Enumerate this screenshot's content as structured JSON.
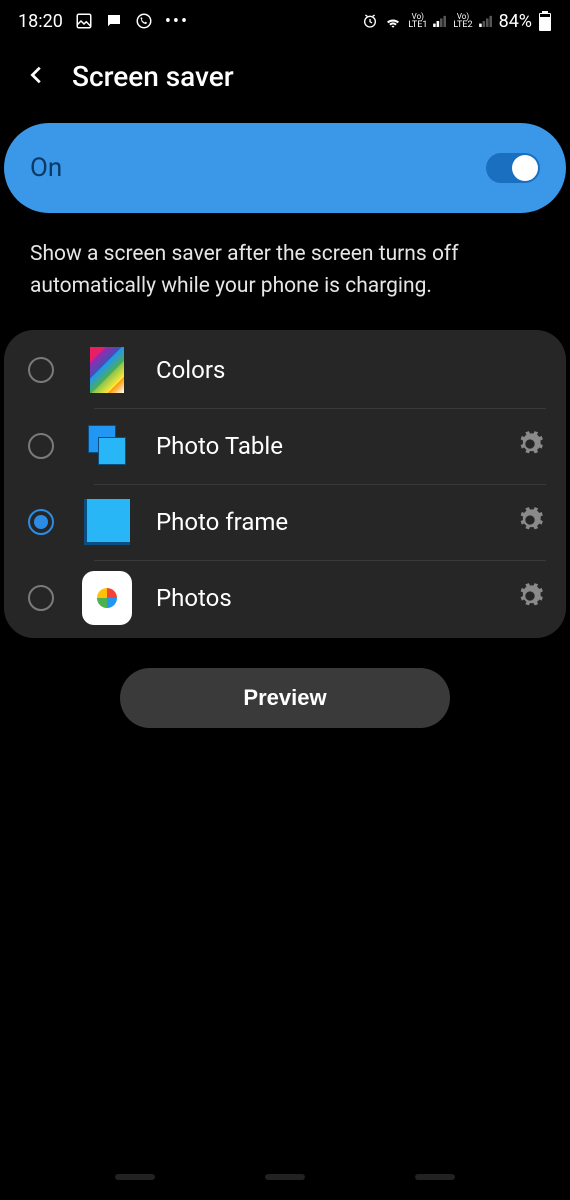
{
  "status": {
    "time": "18:20",
    "battery": "84%"
  },
  "header": {
    "title": "Screen saver"
  },
  "toggle": {
    "label": "On",
    "value": true
  },
  "description": "Show a screen saver after the screen turns off automatically while your phone is charging.",
  "options": [
    {
      "label": "Colors",
      "selected": false,
      "settings": false,
      "icon": "colors"
    },
    {
      "label": "Photo Table",
      "selected": false,
      "settings": true,
      "icon": "photo-table"
    },
    {
      "label": "Photo frame",
      "selected": true,
      "settings": true,
      "icon": "photo-frame"
    },
    {
      "label": "Photos",
      "selected": false,
      "settings": true,
      "icon": "google-photos"
    }
  ],
  "preview_button": "Preview"
}
